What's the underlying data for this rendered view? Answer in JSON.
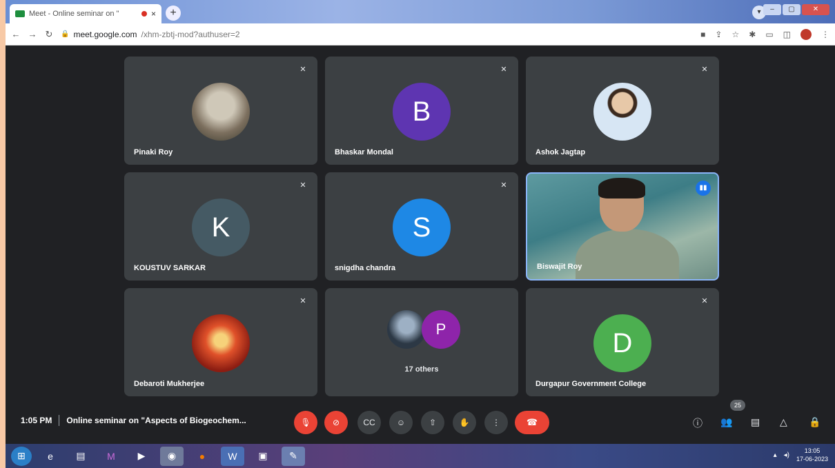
{
  "browser": {
    "tab_title": "Meet - Online seminar on \"",
    "tab_close": "×",
    "new_tab": "+",
    "url_host": "meet.google.com",
    "url_path": "/xhm-zbtj-mod?authuser=2"
  },
  "meet": {
    "participants": [
      {
        "name": "Pinaki Roy"
      },
      {
        "name": "Bhaskar Mondal",
        "initial": "B",
        "color": "#5e35b1"
      },
      {
        "name": "Ashok Jagtap"
      },
      {
        "name": "KOUSTUV SARKAR",
        "initial": "K",
        "color": "#455a64"
      },
      {
        "name": "snigdha chandra",
        "initial": "S",
        "color": "#1e88e5"
      },
      {
        "name": "Biswajit Roy"
      },
      {
        "name": "Debaroti Mukherjee"
      },
      {
        "name": "Durgapur Government College",
        "initial": "D",
        "color": "#4caf50"
      }
    ],
    "others": {
      "label": "17 others",
      "initial": "P"
    },
    "time": "1:05 PM",
    "meeting_title": "Online seminar on \"Aspects of Biogeochem...",
    "people_count": "25"
  },
  "taskbar": {
    "clock": "13:05",
    "date": "17-06-2023"
  }
}
